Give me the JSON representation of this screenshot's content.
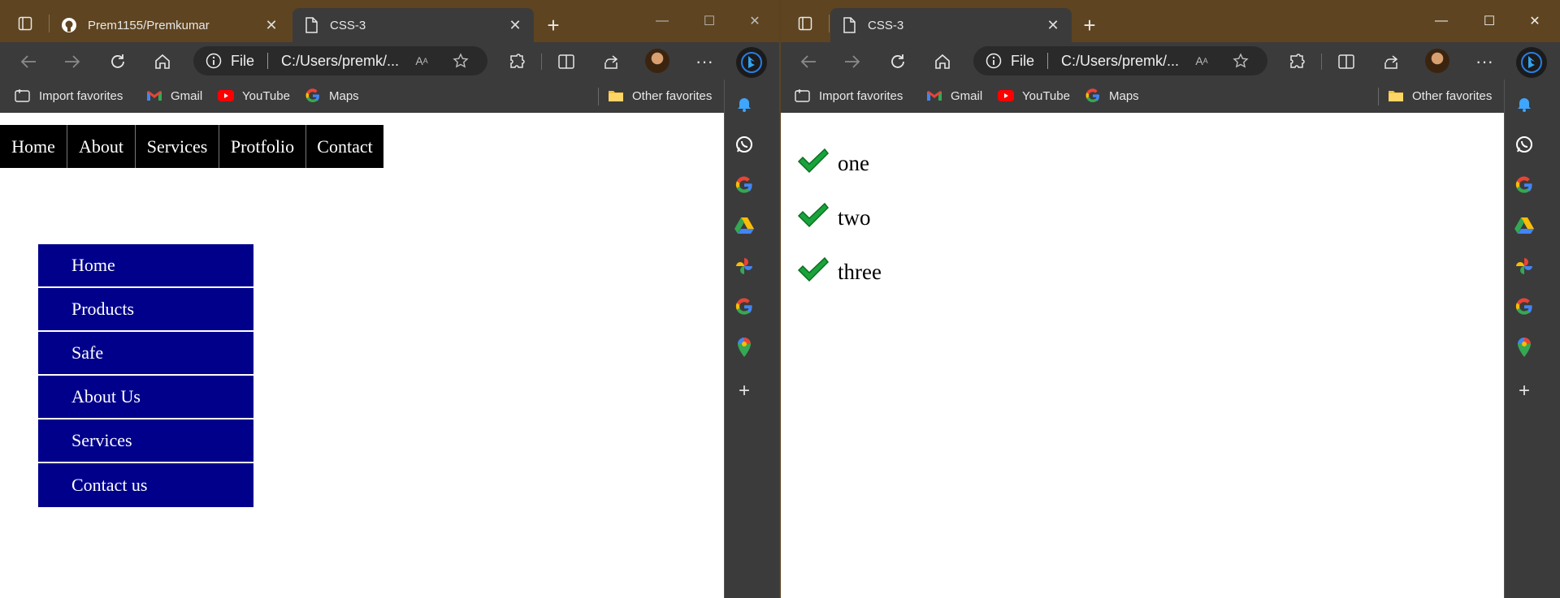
{
  "left_window": {
    "tabs": [
      {
        "label": "Prem1155/Premkumar",
        "icon": "github-icon",
        "active": false
      },
      {
        "label": "CSS-3",
        "icon": "page-icon",
        "active": true
      }
    ],
    "address": {
      "scheme": "File",
      "url": "C:/Users/premk/..."
    },
    "favorites": [
      "Import favorites",
      "Gmail",
      "YouTube",
      "Maps"
    ],
    "other_favorites": "Other favorites",
    "page": {
      "top_nav": [
        "Home",
        "About",
        "Services",
        "Protfolio",
        "Contact"
      ],
      "side_menu": [
        "Home",
        "Products",
        "Safe",
        "About Us",
        "Services",
        "Contact us"
      ]
    }
  },
  "right_window": {
    "tabs": [
      {
        "label": "CSS-3",
        "icon": "page-icon",
        "active": true
      }
    ],
    "address": {
      "scheme": "File",
      "url": "C:/Users/premk/..."
    },
    "favorites": [
      "Import favorites",
      "Gmail",
      "YouTube",
      "Maps"
    ],
    "other_favorites": "Other favorites",
    "page": {
      "checklist": [
        "one",
        "two",
        "three"
      ]
    }
  },
  "sidebar_icons": [
    "bell-icon",
    "whatsapp-icon",
    "google-icon",
    "google-drive-icon",
    "google-photos-icon",
    "google-icon",
    "google-maps-icon",
    "add-icon"
  ],
  "colors": {
    "titlebar": "#5e4420",
    "toolbar": "#3b3b3b",
    "menu_bg": "#00008b",
    "nav_bg": "#000000",
    "check": "#1faa3a"
  }
}
